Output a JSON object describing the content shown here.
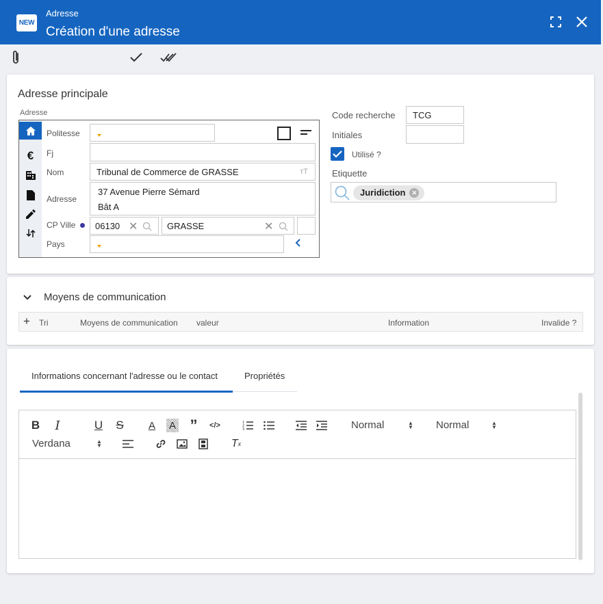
{
  "header": {
    "badge": "NEW",
    "subtitle": "Adresse",
    "title": "Création d'une adresse"
  },
  "address_card": {
    "title": "Adresse principale",
    "box_label": "Adresse",
    "fields": {
      "politesse_label": "Politesse",
      "fj_label": "Fj",
      "nom_label": "Nom",
      "nom_value": "Tribunal de Commerce de GRASSE",
      "adresse_label": "Adresse",
      "adresse_line1": "37 Avenue Pierre Sémard",
      "adresse_line2": "Bât A",
      "cpville_label": "CP Ville",
      "cp_value": "06130",
      "ville_value": "GRASSE",
      "pays_label": "Pays"
    },
    "right": {
      "code_label": "Code recherche",
      "code_value": "TCG",
      "initiales_label": "Initiales",
      "initiales_value": "",
      "utilise_label": "Utilisé ?",
      "utilise_checked": true,
      "etiquette_label": "Etiquette",
      "tag": "Juridiction"
    }
  },
  "communication_card": {
    "title": "Moyens de communication",
    "columns": [
      "Tri",
      "Moyens de communication",
      "valeur",
      "Information",
      "Invalide ?"
    ]
  },
  "info_card": {
    "tabs": [
      "Informations concernant l'adresse ou le contact",
      "Propriétés"
    ],
    "active_tab": 0,
    "editor": {
      "select_1": "Normal",
      "select_2": "Normal",
      "font_select": "Verdana"
    }
  },
  "colors": {
    "header": "#1565c0",
    "accent": "#1565c0",
    "caret": "#f0a000"
  }
}
